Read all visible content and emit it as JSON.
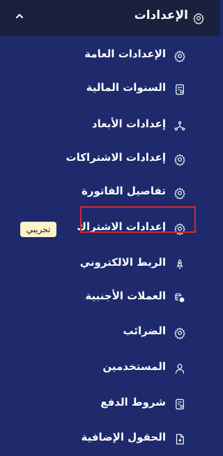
{
  "header": {
    "title": "الإعدادات",
    "icon": "gear-icon",
    "collapse_icon": "chevron-up-icon"
  },
  "menu": {
    "items": [
      {
        "label": "الإعدادات العامة",
        "icon": "gear-icon"
      },
      {
        "label": "السنوات المالية",
        "icon": "document-icon"
      },
      {
        "label": "إعدادات الأبعاد",
        "icon": "network-icon"
      },
      {
        "label": "إعدادات الاشتراكات",
        "icon": "gear-icon"
      },
      {
        "label": "تفاصيل الفاتورة",
        "icon": "gear-icon"
      },
      {
        "label": "إعدادات الاشتراك",
        "icon": "gear-icon"
      },
      {
        "label": "الربط الالكتروني",
        "icon": "rocket-icon"
      },
      {
        "label": "العملات الأجنبية",
        "icon": "currency-icon",
        "highlighted": true
      },
      {
        "label": "الضرائب",
        "icon": "gear-icon"
      },
      {
        "label": "المستخدمين",
        "icon": "user-icon"
      },
      {
        "label": "شروط الدفع",
        "icon": "document-icon"
      },
      {
        "label": "الحقول الإضافية",
        "icon": "file-plus-icon"
      }
    ]
  },
  "badge": {
    "label": "تجريبي"
  },
  "colors": {
    "sidebar_bg": "#1e2a6b",
    "header_bg": "#19213f",
    "badge_bg": "#fdf2c8",
    "highlight_border": "#d22a2a"
  }
}
